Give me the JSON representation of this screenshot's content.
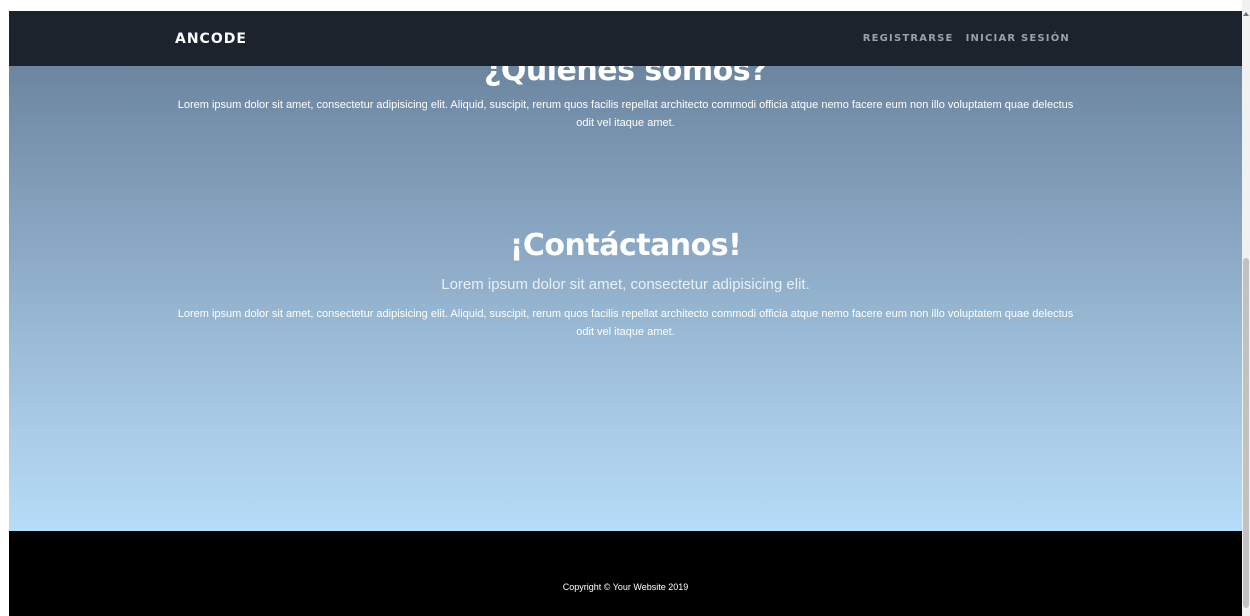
{
  "navbar": {
    "brand": "ANCODE",
    "links": [
      "REGISTRARSE",
      "INICIAR SESIÓN"
    ]
  },
  "about": {
    "title": "¿Quiénes somos?",
    "text": "Lorem ipsum dolor sit amet, consectetur adipisicing elit. Aliquid, suscipit, rerum quos facilis repellat architecto commodi officia atque nemo facere eum non illo voluptatem quae delectus odit vel itaque amet."
  },
  "contact": {
    "title": "¡Contáctanos!",
    "subtitle": "Lorem ipsum dolor sit amet, consectetur adipisicing elit.",
    "text": "Lorem ipsum dolor sit amet, consectetur adipisicing elit. Aliquid, suscipit, rerum quos facilis repellat architecto commodi officia atque nemo facere eum non illo voluptatem quae delectus odit vel itaque amet."
  },
  "footer": {
    "copyright": "Copyright © Your Website 2019"
  },
  "colors": {
    "navbar": "#1c232c",
    "gradient_top": "#627b94",
    "gradient_bottom": "#b5dcf8",
    "footer": "#000000"
  }
}
